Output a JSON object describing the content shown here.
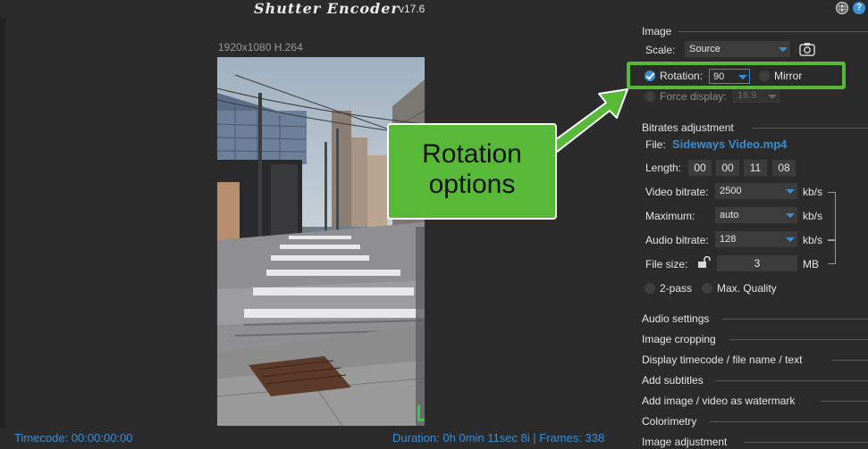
{
  "app": {
    "title": "Shutter Encoder",
    "version": "v17.6"
  },
  "titlebar": {
    "globe_icon": "globe-icon",
    "help_label": "?"
  },
  "preview": {
    "info": "1920x1080 H.264",
    "timecode": "Timecode: 00:00:00:00",
    "duration": "Duration: 0h 0min 11sec 8i | Frames: 338"
  },
  "image_section": {
    "title": "Image",
    "scale_label": "Scale:",
    "scale_value": "Source",
    "rotation_label": "Rotation:",
    "rotation_value": "90",
    "mirror_label": "Mirror",
    "force_display_label": "Force display:",
    "force_display_value": "16:9"
  },
  "callout": {
    "line1": "Rotation",
    "line2": "options"
  },
  "bitrates": {
    "title": "Bitrates adjustment",
    "file_label": "File:",
    "file_value": "Sideways Video.mp4",
    "length_label": "Length:",
    "length_values": [
      "00",
      "00",
      "11",
      "08"
    ],
    "video_bitrate_label": "Video bitrate:",
    "video_bitrate_value": "2500",
    "maximum_label": "Maximum:",
    "maximum_value": "auto",
    "audio_bitrate_label": "Audio bitrate:",
    "audio_bitrate_value": "128",
    "file_size_label": "File size:",
    "file_size_value": "3",
    "kbs_unit": "kb/s",
    "mb_unit": "MB",
    "two_pass_label": "2-pass",
    "max_quality_label": "Max. Quality"
  },
  "sections": [
    "Audio settings",
    "Image cropping",
    "Display timecode / file name / text",
    "Add subtitles",
    "Add image / video as watermark",
    "Colorimetry",
    "Image adjustment"
  ],
  "colors": {
    "accent": "#3a8ed6",
    "highlight": "#58b838",
    "background": "#2b2b2b"
  }
}
